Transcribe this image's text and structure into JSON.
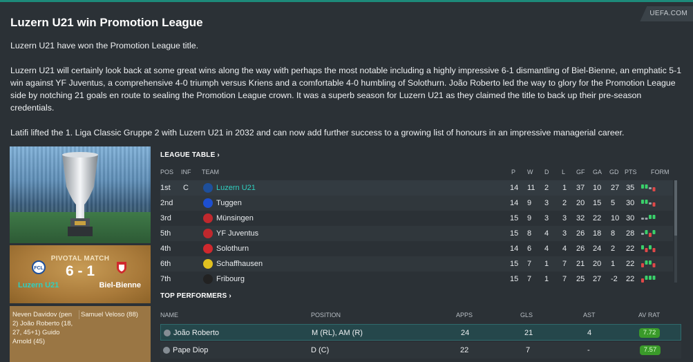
{
  "article": {
    "source": "UEFA.COM",
    "headline": "Luzern U21 win Promotion League",
    "paragraphs": [
      "Luzern U21 have won the Promotion League title.",
      "Luzern U21 will certainly look back at some great wins along the way with perhaps the most notable including a highly impressive 6-1 dismantling of Biel-Bienne, an emphatic 5-1 win against YF Juventus, a comprehensive 4-0 triumph versus Kriens and a comfortable 4-0 humbling of Solothurn. João Roberto led the way to glory for the Promotion League side by notching 21 goals en route to sealing the Promotion League crown. It was a superb season for Luzern U21 as they claimed the title to back up their pre-season credentials.",
      "Latifi lifted the 1. Liga Classic Gruppe 2 with Luzern U21 in 2032 and can now add further success to a growing list of honours in an impressive managerial career."
    ]
  },
  "pivotal_match": {
    "label": "PIVOTAL MATCH",
    "score": "6 - 1",
    "home": "Luzern U21",
    "away": "Biel-Bienne",
    "home_scorers": "Neven Davidov (pen 2) João Roberto (18, 27, 45+1) Guido Arnold (45)",
    "away_scorers": "Samuel Veloso (88)"
  },
  "league_table": {
    "title": "LEAGUE TABLE ›",
    "headers": {
      "pos": "POS",
      "inf": "INF",
      "team": "TEAM",
      "p": "P",
      "w": "W",
      "d": "D",
      "l": "L",
      "gf": "GF",
      "ga": "GA",
      "gd": "GD",
      "pts": "PTS",
      "form": "FORM"
    },
    "rows": [
      {
        "pos": "1st",
        "inf": "C",
        "team": "Luzern U21",
        "p": "14",
        "w": "11",
        "d": "2",
        "l": "1",
        "gf": "37",
        "ga": "10",
        "gd": "27",
        "pts": "35",
        "badge": "#1e4f9a",
        "form": [
          "w",
          "w",
          "d",
          "l"
        ]
      },
      {
        "pos": "2nd",
        "inf": "",
        "team": "Tuggen",
        "p": "14",
        "w": "9",
        "d": "3",
        "l": "2",
        "gf": "20",
        "ga": "15",
        "gd": "5",
        "pts": "30",
        "badge": "#1d4fd0",
        "form": [
          "w",
          "w",
          "d",
          "l"
        ]
      },
      {
        "pos": "3rd",
        "inf": "",
        "team": "Münsingen",
        "p": "15",
        "w": "9",
        "d": "3",
        "l": "3",
        "gf": "32",
        "ga": "22",
        "gd": "10",
        "pts": "30",
        "badge": "#c0282d",
        "form": [
          "d",
          "d",
          "w",
          "w"
        ]
      },
      {
        "pos": "5th",
        "inf": "",
        "team": "YF Juventus",
        "p": "15",
        "w": "8",
        "d": "4",
        "l": "3",
        "gf": "26",
        "ga": "18",
        "gd": "8",
        "pts": "28",
        "badge": "#c0282d",
        "form": [
          "d",
          "w",
          "l",
          "w"
        ]
      },
      {
        "pos": "4th",
        "inf": "",
        "team": "Solothurn",
        "p": "14",
        "w": "6",
        "d": "4",
        "l": "4",
        "gf": "26",
        "ga": "24",
        "gd": "2",
        "pts": "22",
        "badge": "#d0282d",
        "form": [
          "w",
          "l",
          "w",
          "l"
        ]
      },
      {
        "pos": "6th",
        "inf": "",
        "team": "Schaffhausen",
        "p": "15",
        "w": "7",
        "d": "1",
        "l": "7",
        "gf": "21",
        "ga": "20",
        "gd": "1",
        "pts": "22",
        "badge": "#e0c020",
        "form": [
          "l",
          "w",
          "w",
          "l"
        ]
      },
      {
        "pos": "7th",
        "inf": "",
        "team": "Fribourg",
        "p": "15",
        "w": "7",
        "d": "1",
        "l": "7",
        "gf": "25",
        "ga": "27",
        "gd": "-2",
        "pts": "22",
        "badge": "#222222",
        "form": [
          "l",
          "w",
          "w",
          "w"
        ]
      }
    ]
  },
  "top_performers": {
    "title": "TOP PERFORMERS ›",
    "headers": {
      "name": "NAME",
      "position": "POSITION",
      "apps": "APPS",
      "gls": "GLS",
      "ast": "AST",
      "av_rat": "AV RAT"
    },
    "rows": [
      {
        "name": "João Roberto",
        "position": "M (RL), AM (R)",
        "apps": "24",
        "gls": "21",
        "ast": "4",
        "av_rat": "7.72"
      },
      {
        "name": "Pape Diop",
        "position": "D (C)",
        "apps": "22",
        "gls": "7",
        "ast": "-",
        "av_rat": "7.57"
      }
    ]
  },
  "colors": {
    "accent": "#2fd0c0",
    "win": "#3ad16a",
    "draw": "#9aa2a8",
    "loss": "#e04848"
  }
}
